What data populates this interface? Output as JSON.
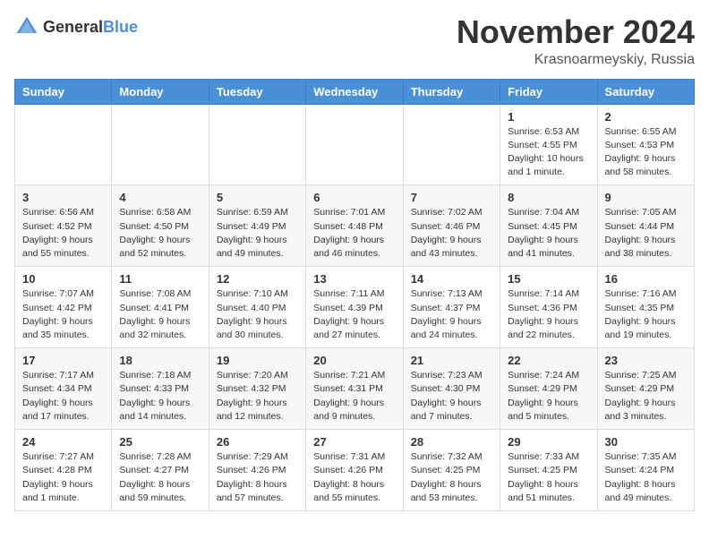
{
  "logo": {
    "text_general": "General",
    "text_blue": "Blue"
  },
  "header": {
    "month_year": "November 2024",
    "location": "Krasnoarmeyskiy, Russia"
  },
  "days_of_week": [
    "Sunday",
    "Monday",
    "Tuesday",
    "Wednesday",
    "Thursday",
    "Friday",
    "Saturday"
  ],
  "weeks": [
    [
      {
        "day": "",
        "info": ""
      },
      {
        "day": "",
        "info": ""
      },
      {
        "day": "",
        "info": ""
      },
      {
        "day": "",
        "info": ""
      },
      {
        "day": "",
        "info": ""
      },
      {
        "day": "1",
        "info": "Sunrise: 6:53 AM\nSunset: 4:55 PM\nDaylight: 10 hours and 1 minute."
      },
      {
        "day": "2",
        "info": "Sunrise: 6:55 AM\nSunset: 4:53 PM\nDaylight: 9 hours and 58 minutes."
      }
    ],
    [
      {
        "day": "3",
        "info": "Sunrise: 6:56 AM\nSunset: 4:52 PM\nDaylight: 9 hours and 55 minutes."
      },
      {
        "day": "4",
        "info": "Sunrise: 6:58 AM\nSunset: 4:50 PM\nDaylight: 9 hours and 52 minutes."
      },
      {
        "day": "5",
        "info": "Sunrise: 6:59 AM\nSunset: 4:49 PM\nDaylight: 9 hours and 49 minutes."
      },
      {
        "day": "6",
        "info": "Sunrise: 7:01 AM\nSunset: 4:48 PM\nDaylight: 9 hours and 46 minutes."
      },
      {
        "day": "7",
        "info": "Sunrise: 7:02 AM\nSunset: 4:46 PM\nDaylight: 9 hours and 43 minutes."
      },
      {
        "day": "8",
        "info": "Sunrise: 7:04 AM\nSunset: 4:45 PM\nDaylight: 9 hours and 41 minutes."
      },
      {
        "day": "9",
        "info": "Sunrise: 7:05 AM\nSunset: 4:44 PM\nDaylight: 9 hours and 38 minutes."
      }
    ],
    [
      {
        "day": "10",
        "info": "Sunrise: 7:07 AM\nSunset: 4:42 PM\nDaylight: 9 hours and 35 minutes."
      },
      {
        "day": "11",
        "info": "Sunrise: 7:08 AM\nSunset: 4:41 PM\nDaylight: 9 hours and 32 minutes."
      },
      {
        "day": "12",
        "info": "Sunrise: 7:10 AM\nSunset: 4:40 PM\nDaylight: 9 hours and 30 minutes."
      },
      {
        "day": "13",
        "info": "Sunrise: 7:11 AM\nSunset: 4:39 PM\nDaylight: 9 hours and 27 minutes."
      },
      {
        "day": "14",
        "info": "Sunrise: 7:13 AM\nSunset: 4:37 PM\nDaylight: 9 hours and 24 minutes."
      },
      {
        "day": "15",
        "info": "Sunrise: 7:14 AM\nSunset: 4:36 PM\nDaylight: 9 hours and 22 minutes."
      },
      {
        "day": "16",
        "info": "Sunrise: 7:16 AM\nSunset: 4:35 PM\nDaylight: 9 hours and 19 minutes."
      }
    ],
    [
      {
        "day": "17",
        "info": "Sunrise: 7:17 AM\nSunset: 4:34 PM\nDaylight: 9 hours and 17 minutes."
      },
      {
        "day": "18",
        "info": "Sunrise: 7:18 AM\nSunset: 4:33 PM\nDaylight: 9 hours and 14 minutes."
      },
      {
        "day": "19",
        "info": "Sunrise: 7:20 AM\nSunset: 4:32 PM\nDaylight: 9 hours and 12 minutes."
      },
      {
        "day": "20",
        "info": "Sunrise: 7:21 AM\nSunset: 4:31 PM\nDaylight: 9 hours and 9 minutes."
      },
      {
        "day": "21",
        "info": "Sunrise: 7:23 AM\nSunset: 4:30 PM\nDaylight: 9 hours and 7 minutes."
      },
      {
        "day": "22",
        "info": "Sunrise: 7:24 AM\nSunset: 4:29 PM\nDaylight: 9 hours and 5 minutes."
      },
      {
        "day": "23",
        "info": "Sunrise: 7:25 AM\nSunset: 4:29 PM\nDaylight: 9 hours and 3 minutes."
      }
    ],
    [
      {
        "day": "24",
        "info": "Sunrise: 7:27 AM\nSunset: 4:28 PM\nDaylight: 9 hours and 1 minute."
      },
      {
        "day": "25",
        "info": "Sunrise: 7:28 AM\nSunset: 4:27 PM\nDaylight: 8 hours and 59 minutes."
      },
      {
        "day": "26",
        "info": "Sunrise: 7:29 AM\nSunset: 4:26 PM\nDaylight: 8 hours and 57 minutes."
      },
      {
        "day": "27",
        "info": "Sunrise: 7:31 AM\nSunset: 4:26 PM\nDaylight: 8 hours and 55 minutes."
      },
      {
        "day": "28",
        "info": "Sunrise: 7:32 AM\nSunset: 4:25 PM\nDaylight: 8 hours and 53 minutes."
      },
      {
        "day": "29",
        "info": "Sunrise: 7:33 AM\nSunset: 4:25 PM\nDaylight: 8 hours and 51 minutes."
      },
      {
        "day": "30",
        "info": "Sunrise: 7:35 AM\nSunset: 4:24 PM\nDaylight: 8 hours and 49 minutes."
      }
    ]
  ]
}
